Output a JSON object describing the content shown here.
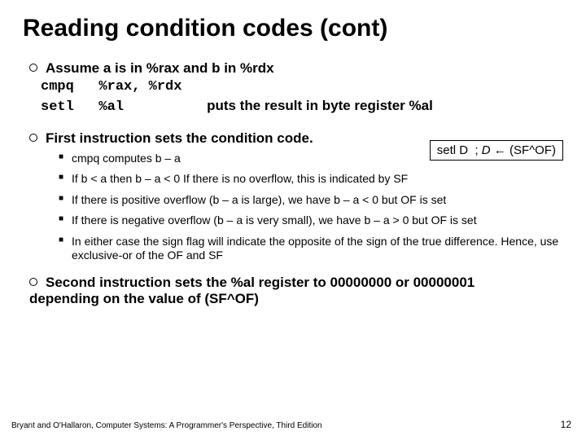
{
  "title": "Reading condition codes (cont)",
  "assume": "Assume a is in %rax and b in %rdx",
  "code": {
    "line1_instr": "cmpq",
    "line1_ops": "%rax, %rdx",
    "line2_instr": "setl",
    "line2_ops": "%al",
    "line2_ann": "puts the result in byte register %al"
  },
  "note": {
    "lhs": "setl D",
    "sep": ";",
    "rhs_d": "D",
    "arrow": "←",
    "rhs_expr": "(SF^OF)"
  },
  "first": "First instruction sets the condition code.",
  "sub": [
    "cmpq computes b – a",
    "If b < a then b – a < 0  If there is no overflow, this is indicated by SF",
    "If there is positive overflow (b – a is large), we have b – a < 0 but OF is set",
    "If there is negative overflow (b – a is very small), we have b – a > 0 but OF is set",
    "In either case the sign flag will indicate the opposite of the sign of the true difference.  Hence, use exclusive-or of the OF and SF"
  ],
  "second": "Second instruction sets the %al register to 00000000 or 00000001 depending on the value of (SF^OF)",
  "footer": "Bryant and O'Hallaron, Computer Systems: A Programmer's Perspective, Third Edition",
  "pagenum": "12"
}
